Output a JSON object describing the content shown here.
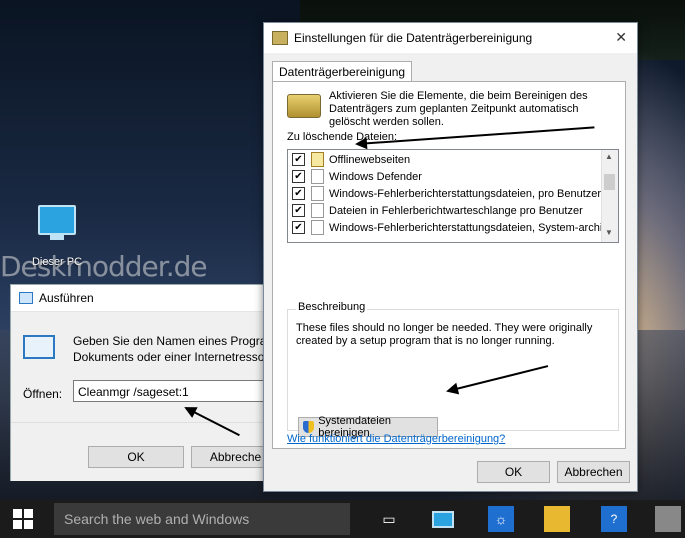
{
  "desktop": {
    "icon_label": "Dieser PC",
    "watermark": "Deskmodder.de"
  },
  "run_dialog": {
    "title": "Ausführen",
    "description_line1": "Geben Sie den Namen eines Program",
    "description_line2": "Dokuments oder einer Internetressou",
    "open_label": "Öffnen:",
    "open_value": "Cleanmgr /sageset:1",
    "ok_label": "OK",
    "cancel_label": "Abbreche"
  },
  "cleanup_dialog": {
    "title": "Einstellungen für die Datenträgerbereinigung",
    "close_glyph": "✕",
    "tab_label": "Datenträgerbereinigung",
    "intro_text": "Aktivieren Sie die Elemente, die beim Bereinigen des Datenträgers zum geplanten Zeitpunkt automatisch gelöscht werden sollen.",
    "files_label": "Zu löschende Dateien:",
    "files": [
      {
        "label": "Offlinewebseiten",
        "checked": true,
        "icon": "offline-pages-icon"
      },
      {
        "label": "Windows Defender",
        "checked": true,
        "icon": "file-icon"
      },
      {
        "label": "Windows-Fehlerberichterstattungsdateien, pro Benutzer...",
        "checked": true,
        "icon": "file-icon"
      },
      {
        "label": "Dateien in Fehlerberichtwarteschlange pro Benutzer",
        "checked": true,
        "icon": "file-icon"
      },
      {
        "label": "Windows-Fehlerberichterstattungsdateien, System-archi...",
        "checked": true,
        "icon": "file-icon"
      }
    ],
    "description_legend": "Beschreibung",
    "description_text": "These files should no longer be needed. They were originally created by a setup program that is no longer running.",
    "system_files_button": "Systemdateien bereinigen",
    "help_link": "Wie funktioniert die Datenträgerbereinigung?",
    "ok_label": "OK",
    "cancel_label": "Abbrechen"
  },
  "taskbar": {
    "search_placeholder": "Search the web and Windows",
    "items": [
      "task-view-icon",
      "this-pc-icon",
      "settings-icon",
      "file-explorer-icon",
      "help-icon",
      "printer-icon"
    ]
  }
}
